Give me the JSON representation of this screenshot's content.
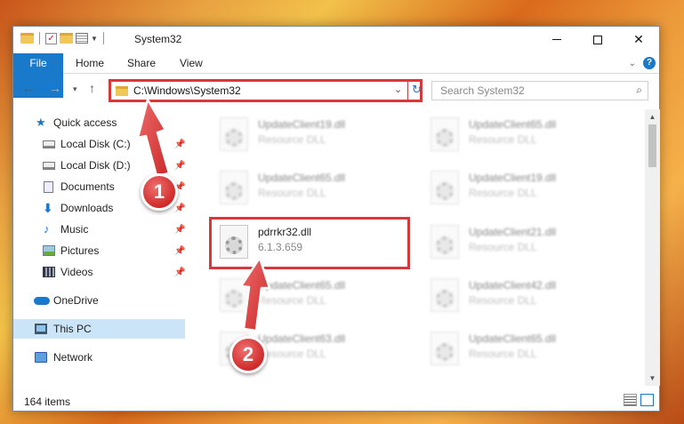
{
  "window": {
    "title": "System32",
    "minimize_glyph": "",
    "maximize_glyph": "",
    "close_glyph": "✕"
  },
  "ribbon": {
    "tabs": [
      "File",
      "Home",
      "Share",
      "View"
    ],
    "help_glyph": "?"
  },
  "address": {
    "path": "C:\\Windows\\System32",
    "search_placeholder": "Search System32"
  },
  "sidebar": {
    "items": [
      {
        "label": "Quick access",
        "icon": "star-icon"
      },
      {
        "label": "Local Disk (C:)",
        "icon": "disk-icon",
        "pinned": true
      },
      {
        "label": "Local Disk (D:)",
        "icon": "disk-icon",
        "pinned": true
      },
      {
        "label": "Documents",
        "icon": "documents-icon",
        "pinned": true
      },
      {
        "label": "Downloads",
        "icon": "download-icon",
        "pinned": true
      },
      {
        "label": "Music",
        "icon": "music-icon",
        "pinned": true
      },
      {
        "label": "Pictures",
        "icon": "pictures-icon",
        "pinned": true
      },
      {
        "label": "Videos",
        "icon": "videos-icon",
        "pinned": true
      },
      {
        "label": "OneDrive",
        "icon": "cloud-icon"
      },
      {
        "label": "This PC",
        "icon": "computer-icon",
        "selected": true
      },
      {
        "label": "Network",
        "icon": "network-icon"
      }
    ]
  },
  "files": [
    {
      "name": "UpdateClient19.dll",
      "desc": "Resource DLL"
    },
    {
      "name": "UpdateClient65.dll",
      "desc": "Resource DLL"
    },
    {
      "name": "UpdateClient65.dll",
      "desc": "Resource DLL"
    },
    {
      "name": "UpdateClient19.dll",
      "desc": "Resource DLL"
    },
    {
      "name": "pdrrkr32.dll",
      "desc": "6.1.3.659"
    },
    {
      "name": "UpdateClient21.dll",
      "desc": "Resource DLL"
    },
    {
      "name": "UpdateClient65.dll",
      "desc": "Resource DLL"
    },
    {
      "name": "UpdateClient42.dll",
      "desc": "Resource DLL"
    },
    {
      "name": "UpdateClient63.dll",
      "desc": "Resource DLL"
    },
    {
      "name": "UpdateClient65.dll",
      "desc": "Resource DLL"
    }
  ],
  "status": {
    "item_count": "164 items"
  },
  "annotations": {
    "step1": "1",
    "step2": "2"
  },
  "colors": {
    "accent": "#1979ca",
    "highlight": "#d9373a",
    "selected_bg": "#cce4f7"
  }
}
